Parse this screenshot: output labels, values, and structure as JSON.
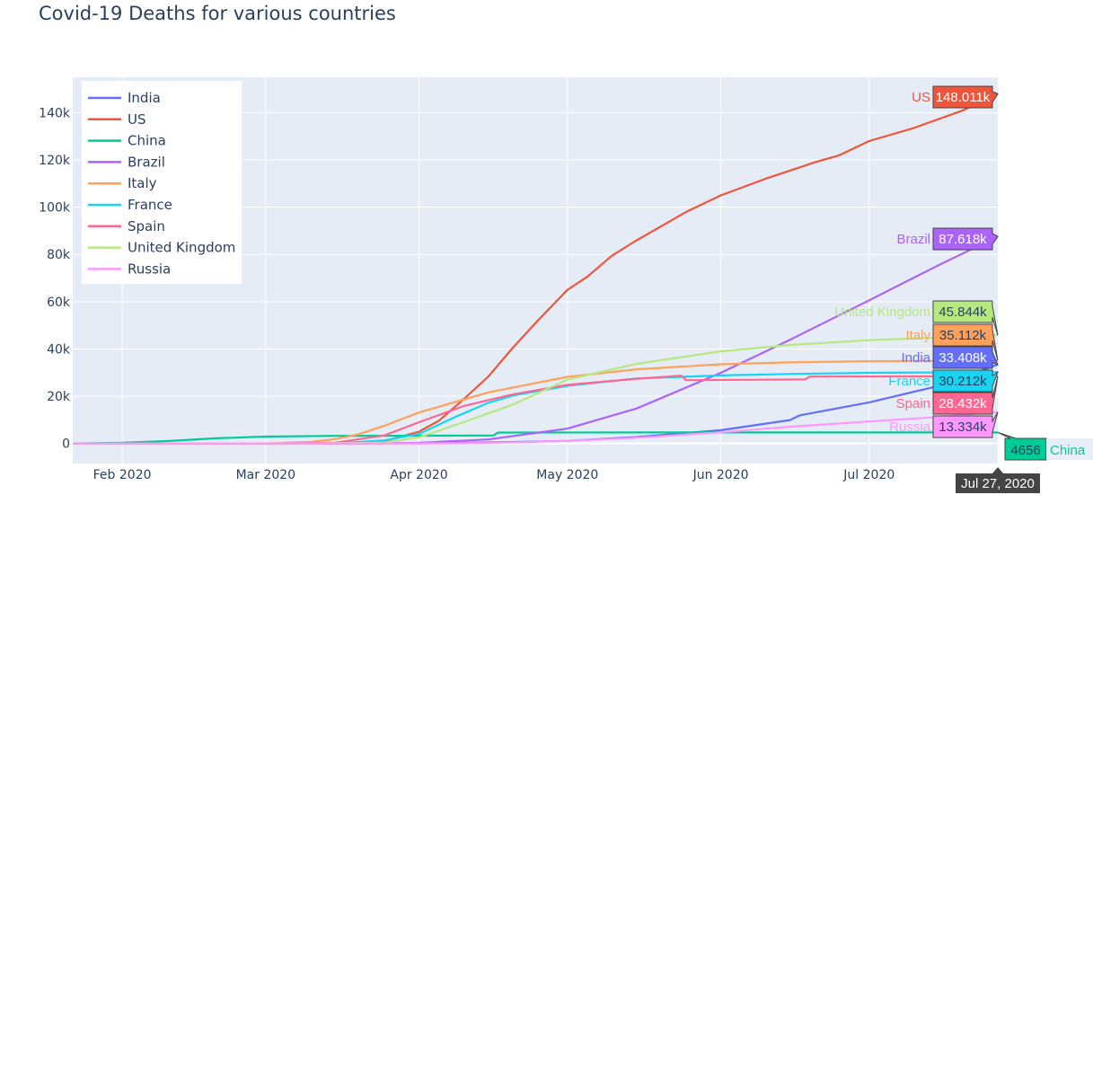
{
  "chart_data": {
    "type": "line",
    "title": "Covid-19 Deaths for various countries",
    "xlabel": "",
    "ylabel": "",
    "xlim": [
      "2020-01-22",
      "2020-07-27"
    ],
    "ylim": [
      -8500,
      155000
    ],
    "grid": true,
    "legend_position": "top-left",
    "x_ticks": [
      {
        "date": "2020-02-01",
        "label": "Feb 2020"
      },
      {
        "date": "2020-03-01",
        "label": "Mar 2020"
      },
      {
        "date": "2020-04-01",
        "label": "Apr 2020"
      },
      {
        "date": "2020-05-01",
        "label": "May 2020"
      },
      {
        "date": "2020-06-01",
        "label": "Jun 2020"
      },
      {
        "date": "2020-07-01",
        "label": "Jul 2020"
      }
    ],
    "y_ticks": [
      {
        "value": 0,
        "label": "0"
      },
      {
        "value": 20000,
        "label": "20k"
      },
      {
        "value": 40000,
        "label": "40k"
      },
      {
        "value": 60000,
        "label": "60k"
      },
      {
        "value": 80000,
        "label": "80k"
      },
      {
        "value": 100000,
        "label": "100k"
      },
      {
        "value": 120000,
        "label": "120k"
      },
      {
        "value": 140000,
        "label": "140k"
      }
    ],
    "hover_date": "Jul 27, 2020",
    "series": [
      {
        "name": "India",
        "color": "#636efa",
        "hover_value": "33.408k",
        "points": [
          [
            "2020-01-22",
            0
          ],
          [
            "2020-03-10",
            0
          ],
          [
            "2020-04-01",
            50
          ],
          [
            "2020-04-15",
            400
          ],
          [
            "2020-05-01",
            1100
          ],
          [
            "2020-05-15",
            2700
          ],
          [
            "2020-06-01",
            5600
          ],
          [
            "2020-06-15",
            9900
          ],
          [
            "2020-06-17",
            11900
          ],
          [
            "2020-07-01",
            17400
          ],
          [
            "2020-07-15",
            24300
          ],
          [
            "2020-07-27",
            33408
          ]
        ]
      },
      {
        "name": "US",
        "color": "#ef553b",
        "hover_value": "148.011k",
        "points": [
          [
            "2020-01-22",
            0
          ],
          [
            "2020-03-01",
            1
          ],
          [
            "2020-03-15",
            60
          ],
          [
            "2020-03-20",
            250
          ],
          [
            "2020-03-25",
            1000
          ],
          [
            "2020-04-01",
            5000
          ],
          [
            "2020-04-05",
            9600
          ],
          [
            "2020-04-10",
            18700
          ],
          [
            "2020-04-15",
            28300
          ],
          [
            "2020-04-20",
            40600
          ],
          [
            "2020-04-25",
            52000
          ],
          [
            "2020-05-01",
            65000
          ],
          [
            "2020-05-05",
            70500
          ],
          [
            "2020-05-10",
            79500
          ],
          [
            "2020-05-15",
            86000
          ],
          [
            "2020-05-20",
            92000
          ],
          [
            "2020-05-25",
            98000
          ],
          [
            "2020-06-01",
            105000
          ],
          [
            "2020-06-10",
            112000
          ],
          [
            "2020-06-20",
            119000
          ],
          [
            "2020-06-25",
            122000
          ],
          [
            "2020-07-01",
            128000
          ],
          [
            "2020-07-10",
            133500
          ],
          [
            "2020-07-20",
            141000
          ],
          [
            "2020-07-27",
            148011
          ]
        ]
      },
      {
        "name": "China",
        "color": "#00cc96",
        "hover_value": "4656",
        "points": [
          [
            "2020-01-22",
            17
          ],
          [
            "2020-02-01",
            300
          ],
          [
            "2020-02-10",
            1000
          ],
          [
            "2020-02-20",
            2200
          ],
          [
            "2020-03-01",
            2900
          ],
          [
            "2020-03-15",
            3200
          ],
          [
            "2020-04-01",
            3300
          ],
          [
            "2020-04-16",
            3350
          ],
          [
            "2020-04-17",
            4630
          ],
          [
            "2020-05-15",
            4640
          ],
          [
            "2020-07-27",
            4656
          ]
        ]
      },
      {
        "name": "Brazil",
        "color": "#ab63fa",
        "hover_value": "87.618k",
        "points": [
          [
            "2020-01-22",
            0
          ],
          [
            "2020-03-20",
            10
          ],
          [
            "2020-04-01",
            240
          ],
          [
            "2020-04-15",
            1700
          ],
          [
            "2020-05-01",
            6300
          ],
          [
            "2020-05-15",
            14800
          ],
          [
            "2020-06-01",
            29900
          ],
          [
            "2020-06-15",
            43900
          ],
          [
            "2020-07-01",
            60600
          ],
          [
            "2020-07-15",
            75400
          ],
          [
            "2020-07-27",
            87618
          ]
        ]
      },
      {
        "name": "Italy",
        "color": "#ffa15a",
        "hover_value": "35.112k",
        "points": [
          [
            "2020-01-22",
            0
          ],
          [
            "2020-02-22",
            1
          ],
          [
            "2020-03-01",
            30
          ],
          [
            "2020-03-10",
            630
          ],
          [
            "2020-03-15",
            1800
          ],
          [
            "2020-03-20",
            4000
          ],
          [
            "2020-03-25",
            7500
          ],
          [
            "2020-04-01",
            13100
          ],
          [
            "2020-04-15",
            21600
          ],
          [
            "2020-05-01",
            28200
          ],
          [
            "2020-05-15",
            31400
          ],
          [
            "2020-06-01",
            33500
          ],
          [
            "2020-06-15",
            34300
          ],
          [
            "2020-07-01",
            34800
          ],
          [
            "2020-07-27",
            35112
          ]
        ]
      },
      {
        "name": "France",
        "color": "#19d3f3",
        "hover_value": "30.212k",
        "points": [
          [
            "2020-01-22",
            0
          ],
          [
            "2020-03-01",
            2
          ],
          [
            "2020-03-15",
            100
          ],
          [
            "2020-03-25",
            1300
          ],
          [
            "2020-04-01",
            4000
          ],
          [
            "2020-04-08",
            10900
          ],
          [
            "2020-04-15",
            17200
          ],
          [
            "2020-04-20",
            20300
          ],
          [
            "2020-05-01",
            24400
          ],
          [
            "2020-05-15",
            27500
          ],
          [
            "2020-06-01",
            28800
          ],
          [
            "2020-06-15",
            29400
          ],
          [
            "2020-07-01",
            29900
          ],
          [
            "2020-07-27",
            30212
          ]
        ]
      },
      {
        "name": "Spain",
        "color": "#ff6692",
        "hover_value": "28.432k",
        "points": [
          [
            "2020-01-22",
            0
          ],
          [
            "2020-03-05",
            1
          ],
          [
            "2020-03-15",
            290
          ],
          [
            "2020-03-25",
            3400
          ],
          [
            "2020-04-01",
            9000
          ],
          [
            "2020-04-10",
            15800
          ],
          [
            "2020-04-20",
            20800
          ],
          [
            "2020-05-01",
            24800
          ],
          [
            "2020-05-15",
            27400
          ],
          [
            "2020-05-24",
            28700
          ],
          [
            "2020-05-25",
            26800
          ],
          [
            "2020-06-18",
            27100
          ],
          [
            "2020-06-19",
            28300
          ],
          [
            "2020-07-27",
            28432
          ]
        ]
      },
      {
        "name": "United Kingdom",
        "color": "#b6e880",
        "hover_value": "45.844k",
        "points": [
          [
            "2020-01-22",
            0
          ],
          [
            "2020-03-10",
            10
          ],
          [
            "2020-03-20",
            200
          ],
          [
            "2020-03-25",
            400
          ],
          [
            "2020-04-01",
            2600
          ],
          [
            "2020-04-10",
            9000
          ],
          [
            "2020-04-20",
            16500
          ],
          [
            "2020-05-01",
            27000
          ],
          [
            "2020-05-15",
            33700
          ],
          [
            "2020-06-01",
            39000
          ],
          [
            "2020-06-15",
            41700
          ],
          [
            "2020-07-01",
            43700
          ],
          [
            "2020-07-27",
            45844
          ]
        ]
      },
      {
        "name": "Russia",
        "color": "#ff97ff",
        "hover_value": "13.334k",
        "points": [
          [
            "2020-01-22",
            0
          ],
          [
            "2020-04-01",
            20
          ],
          [
            "2020-04-15",
            170
          ],
          [
            "2020-05-01",
            1070
          ],
          [
            "2020-05-15",
            2400
          ],
          [
            "2020-06-01",
            4700
          ],
          [
            "2020-06-15",
            7100
          ],
          [
            "2020-07-01",
            9300
          ],
          [
            "2020-07-15",
            11200
          ],
          [
            "2020-07-27",
            13334
          ]
        ]
      }
    ]
  }
}
